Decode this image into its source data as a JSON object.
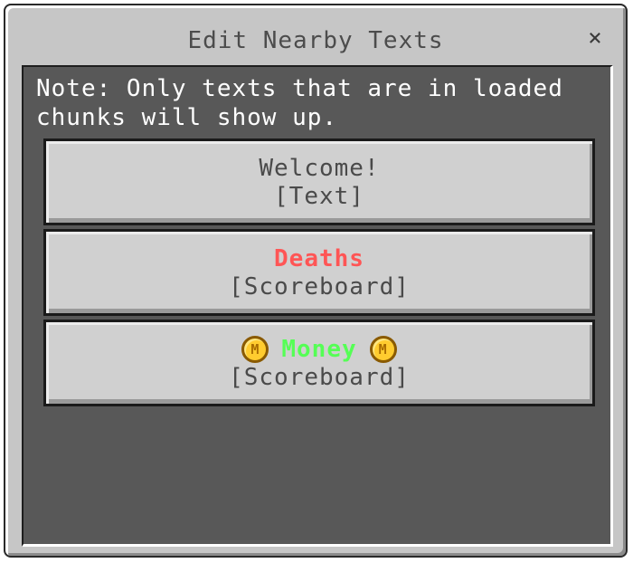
{
  "dialog": {
    "title": "Edit Nearby Texts",
    "close_label": "×"
  },
  "note": "Note: Only texts that are in loaded chunks will show up.",
  "entries": [
    {
      "name": "Welcome!",
      "type": "[Text]",
      "color": "#4a4a4a"
    },
    {
      "name": "Deaths",
      "type": "[Scoreboard]",
      "color": "#ff5555"
    },
    {
      "name": "Money",
      "type": "[Scoreboard]",
      "color": "#55ff55",
      "icon": "coin-icon",
      "icon_letter": "M"
    }
  ]
}
